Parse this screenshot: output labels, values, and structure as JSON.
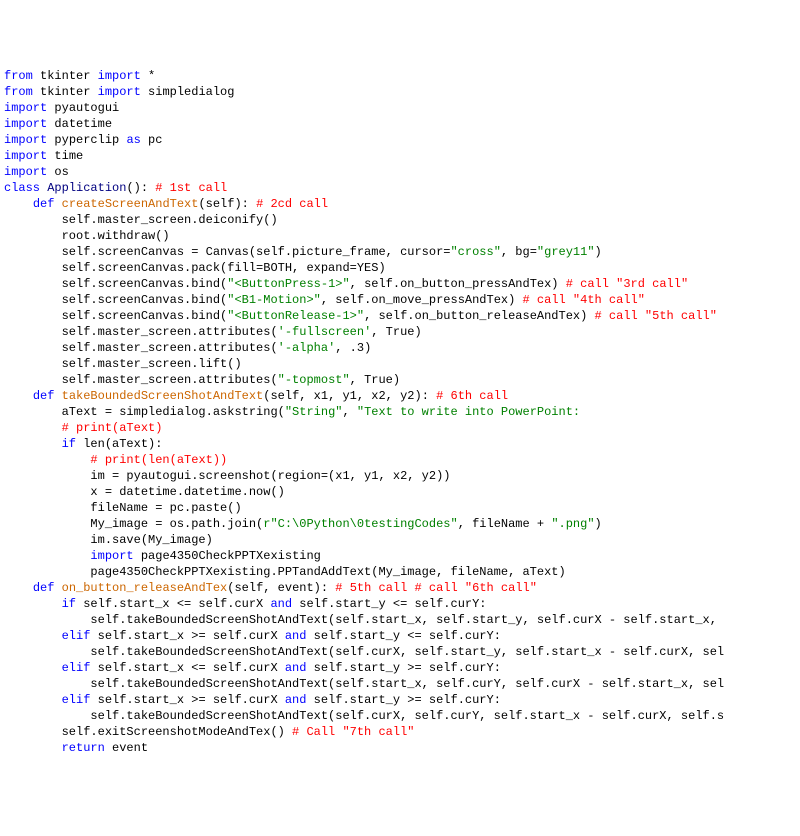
{
  "lines": [
    [
      [
        "kw",
        "from"
      ],
      [
        "txt",
        " tkinter "
      ],
      [
        "kw",
        "import"
      ],
      [
        "txt",
        " *"
      ]
    ],
    [
      [
        "kw",
        "from"
      ],
      [
        "txt",
        " tkinter "
      ],
      [
        "kw",
        "import"
      ],
      [
        "txt",
        " simpledialog"
      ]
    ],
    [
      [
        "kw",
        "import"
      ],
      [
        "txt",
        " pyautogui"
      ]
    ],
    [
      [
        "kw",
        "import"
      ],
      [
        "txt",
        " datetime"
      ]
    ],
    [
      [
        "kw",
        "import"
      ],
      [
        "txt",
        " pyperclip "
      ],
      [
        "kw",
        "as"
      ],
      [
        "txt",
        " pc"
      ]
    ],
    [
      [
        "kw",
        "import"
      ],
      [
        "txt",
        " time"
      ]
    ],
    [
      [
        "kw",
        "import"
      ],
      [
        "txt",
        " os"
      ]
    ],
    [
      [
        "txt",
        ""
      ]
    ],
    [
      [
        "kw",
        "class"
      ],
      [
        "txt",
        " "
      ],
      [
        "cls",
        "Application"
      ],
      [
        "txt",
        "(): "
      ],
      [
        "cmt",
        "# 1st call"
      ]
    ],
    [
      [
        "txt",
        "    "
      ],
      [
        "kw",
        "def"
      ],
      [
        "txt",
        " "
      ],
      [
        "fn",
        "createScreenAndText"
      ],
      [
        "txt",
        "(self): "
      ],
      [
        "cmt",
        "# 2cd call"
      ]
    ],
    [
      [
        "txt",
        "        self.master_screen.deiconify()"
      ]
    ],
    [
      [
        "txt",
        "        root.withdraw()"
      ]
    ],
    [
      [
        "txt",
        "        self.screenCanvas = Canvas(self.picture_frame, cursor="
      ],
      [
        "str",
        "\"cross\""
      ],
      [
        "txt",
        ", bg="
      ],
      [
        "str",
        "\"grey11\""
      ],
      [
        "txt",
        ")"
      ]
    ],
    [
      [
        "txt",
        "        self.screenCanvas.pack(fill=BOTH, expand=YES)"
      ]
    ],
    [
      [
        "txt",
        "        self.screenCanvas.bind("
      ],
      [
        "str",
        "\"<ButtonPress-1>\""
      ],
      [
        "txt",
        ", self.on_button_pressAndTex) "
      ],
      [
        "cmt",
        "# call \"3rd call\""
      ]
    ],
    [
      [
        "txt",
        "        self.screenCanvas.bind("
      ],
      [
        "str",
        "\"<B1-Motion>\""
      ],
      [
        "txt",
        ", self.on_move_pressAndTex) "
      ],
      [
        "cmt",
        "# call \"4th call\""
      ]
    ],
    [
      [
        "txt",
        "        self.screenCanvas.bind("
      ],
      [
        "str",
        "\"<ButtonRelease-1>\""
      ],
      [
        "txt",
        ", self.on_button_releaseAndTex) "
      ],
      [
        "cmt",
        "# call \"5th call\""
      ]
    ],
    [
      [
        "txt",
        "        self.master_screen.attributes("
      ],
      [
        "str",
        "'-fullscreen'"
      ],
      [
        "txt",
        ", True)"
      ]
    ],
    [
      [
        "txt",
        "        self.master_screen.attributes("
      ],
      [
        "str",
        "'-alpha'"
      ],
      [
        "txt",
        ", .3)"
      ]
    ],
    [
      [
        "txt",
        "        self.master_screen.lift()"
      ]
    ],
    [
      [
        "txt",
        "        self.master_screen.attributes("
      ],
      [
        "str",
        "\"-topmost\""
      ],
      [
        "txt",
        ", True)"
      ]
    ],
    [
      [
        "txt",
        ""
      ]
    ],
    [
      [
        "txt",
        ""
      ]
    ],
    [
      [
        "txt",
        "    "
      ],
      [
        "kw",
        "def"
      ],
      [
        "txt",
        " "
      ],
      [
        "fn",
        "takeBoundedScreenShotAndText"
      ],
      [
        "txt",
        "(self, x1, y1, x2, y2): "
      ],
      [
        "cmt",
        "# 6th call"
      ]
    ],
    [
      [
        "txt",
        "        aText = simpledialog.askstring("
      ],
      [
        "str",
        "\"String\""
      ],
      [
        "txt",
        ", "
      ],
      [
        "str",
        "\"Text to write into PowerPoint:"
      ]
    ],
    [
      [
        "txt",
        "        "
      ],
      [
        "cmt",
        "# print(aText)"
      ]
    ],
    [
      [
        "txt",
        "        "
      ],
      [
        "kw",
        "if"
      ],
      [
        "txt",
        " len(aText):"
      ]
    ],
    [
      [
        "txt",
        "            "
      ],
      [
        "cmt",
        "# print(len(aText))"
      ]
    ],
    [
      [
        "txt",
        "            im = pyautogui.screenshot(region=(x1, y1, x2, y2))"
      ]
    ],
    [
      [
        "txt",
        "            x = datetime.datetime.now()"
      ]
    ],
    [
      [
        "txt",
        "            fileName = pc.paste()"
      ]
    ],
    [
      [
        "txt",
        "            My_image = os.path.join("
      ],
      [
        "str",
        "r\"C:\\0Python\\0testingCodes\""
      ],
      [
        "txt",
        ", fileName + "
      ],
      [
        "str",
        "\".png\""
      ],
      [
        "txt",
        ")"
      ]
    ],
    [
      [
        "txt",
        "            im.save(My_image)"
      ]
    ],
    [
      [
        "txt",
        "            "
      ],
      [
        "kw",
        "import"
      ],
      [
        "txt",
        " page4350CheckPPTXexisting"
      ]
    ],
    [
      [
        "txt",
        "            page4350CheckPPTXexisting.PPTandAddText(My_image, fileName, aText)"
      ]
    ],
    [
      [
        "txt",
        ""
      ]
    ],
    [
      [
        "txt",
        "    "
      ],
      [
        "kw",
        "def"
      ],
      [
        "txt",
        " "
      ],
      [
        "fn",
        "on_button_releaseAndTex"
      ],
      [
        "txt",
        "(self, event): "
      ],
      [
        "cmt",
        "# 5th call # call \"6th call\""
      ]
    ],
    [
      [
        "txt",
        "        "
      ],
      [
        "kw",
        "if"
      ],
      [
        "txt",
        " self.start_x <= self.curX "
      ],
      [
        "kw",
        "and"
      ],
      [
        "txt",
        " self.start_y <= self.curY:"
      ]
    ],
    [
      [
        "txt",
        "            self.takeBoundedScreenShotAndText(self.start_x, self.start_y, self.curX - self.start_x,"
      ]
    ],
    [
      [
        "txt",
        "        "
      ],
      [
        "kw",
        "elif"
      ],
      [
        "txt",
        " self.start_x >= self.curX "
      ],
      [
        "kw",
        "and"
      ],
      [
        "txt",
        " self.start_y <= self.curY:"
      ]
    ],
    [
      [
        "txt",
        "            self.takeBoundedScreenShotAndText(self.curX, self.start_y, self.start_x - self.curX, sel"
      ]
    ],
    [
      [
        "txt",
        "        "
      ],
      [
        "kw",
        "elif"
      ],
      [
        "txt",
        " self.start_x <= self.curX "
      ],
      [
        "kw",
        "and"
      ],
      [
        "txt",
        " self.start_y >= self.curY:"
      ]
    ],
    [
      [
        "txt",
        "            self.takeBoundedScreenShotAndText(self.start_x, self.curY, self.curX - self.start_x, sel"
      ]
    ],
    [
      [
        "txt",
        "        "
      ],
      [
        "kw",
        "elif"
      ],
      [
        "txt",
        " self.start_x >= self.curX "
      ],
      [
        "kw",
        "and"
      ],
      [
        "txt",
        " self.start_y >= self.curY:"
      ]
    ],
    [
      [
        "txt",
        "            self.takeBoundedScreenShotAndText(self.curX, self.curY, self.start_x - self.curX, self.s"
      ]
    ],
    [
      [
        "txt",
        "        self.exitScreenshotModeAndTex() "
      ],
      [
        "cmt",
        "# Call \"7th call\""
      ]
    ],
    [
      [
        "txt",
        "        "
      ],
      [
        "kw",
        "return"
      ],
      [
        "txt",
        " event"
      ]
    ]
  ]
}
